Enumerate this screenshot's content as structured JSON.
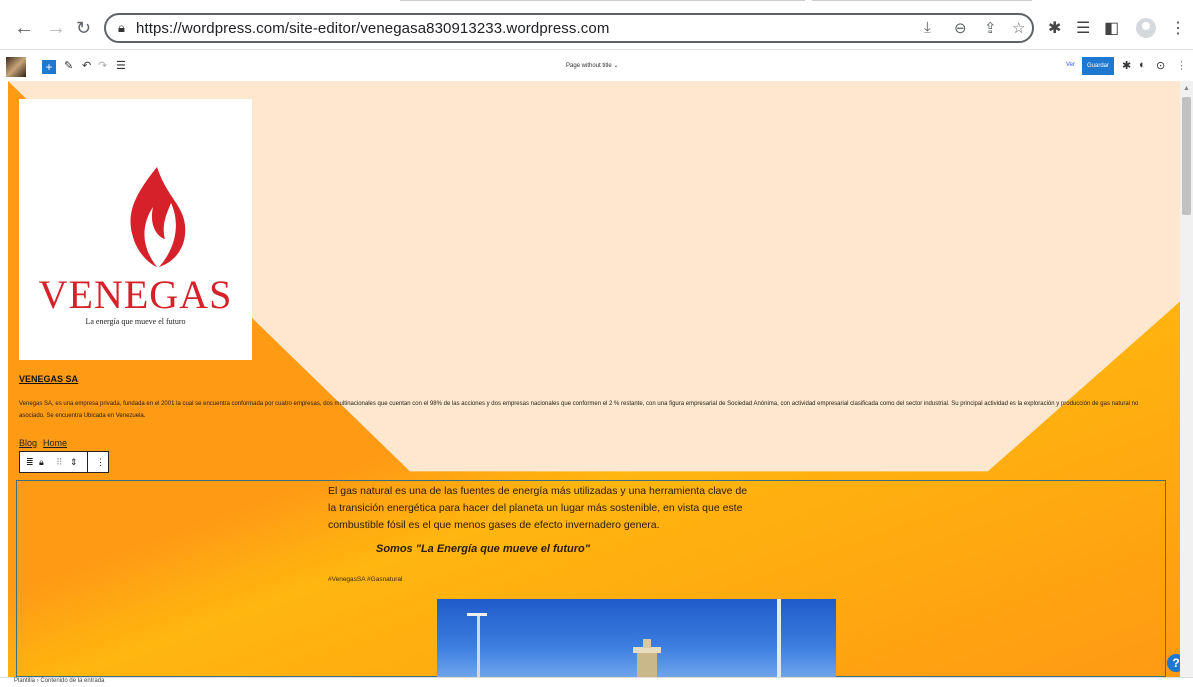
{
  "browser": {
    "url": "https://wordpress.com/site-editor/venegasa830913233.wordpress.com",
    "icons": [
      "back-icon",
      "forward-icon",
      "reload-icon",
      "lock-icon",
      "install-icon",
      "zoom-icon",
      "share-icon",
      "star-icon",
      "extensions-icon",
      "reading-list-icon",
      "side-panel-icon",
      "profile-icon",
      "menu-icon"
    ]
  },
  "editor": {
    "document_title": "Page without title",
    "view_label": "Ver",
    "save_label": "Guardar"
  },
  "logo": {
    "brand": "VENEGAS",
    "tagline": "La energía que mueve el futuro"
  },
  "site": {
    "title": "VENEGAS SA",
    "description": "Venegas SA, es una empresa privada, fundada en el 2001 la cual se encuentra conformada por cuatro empresas, dos multinacionales que cuentan con el 98% de las acciones y dos empresas nacionales que conformen el 2 % restante, con una figura empresarial de Sociedad Anónima, con actividad empresarial clasificada como del sector industrial. Su principal actividad es la exploración y producción de gas natural no asociado. Se encuentra Ubicada en Venezuela.",
    "nav": [
      "Blog",
      "Home"
    ]
  },
  "content": {
    "paragraph": "El gas natural es una de las fuentes de energía más utilizadas y una herramienta clave de la transición energética para hacer del planeta un lugar más sostenible, en vista que este combustible fósil es el que menos gases de efecto invernadero genera.",
    "slogan": "Somos \"La Energía que mueve el futuro\"",
    "hashtags": "#VenegasSA #Gasnatural"
  },
  "footer": {
    "breadcrumb_1": "Plantilla",
    "breadcrumb_sep": "›",
    "breadcrumb_2": "Contenido de la entrada"
  },
  "colors": {
    "accent": "#1e78d0",
    "orange": "#ff9a15",
    "cream": "#fde8cf",
    "brand_red": "#d6212a"
  }
}
